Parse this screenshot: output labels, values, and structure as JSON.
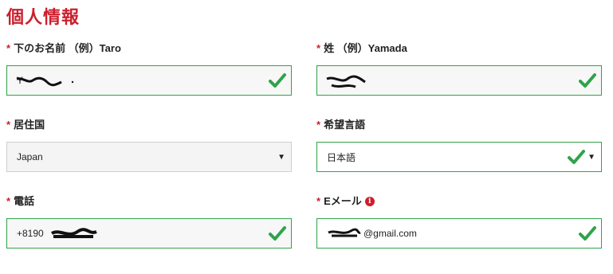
{
  "section_title": "個人情報",
  "required_mark": "*",
  "fields": {
    "first_name": {
      "label": "下のお名前 （例）Taro",
      "value": "Y"
    },
    "last_name": {
      "label": "姓 （例）Yamada",
      "value": ""
    },
    "country": {
      "label": "居住国",
      "value": "Japan"
    },
    "language": {
      "label": "希望言語",
      "value": "日本語"
    },
    "phone": {
      "label": "電話",
      "value": "+8190"
    },
    "email": {
      "label": "Eメール",
      "value": "@gmail.com"
    }
  },
  "icons": {
    "valid": "check-icon",
    "dropdown": "caret-down-icon",
    "info": "info-icon"
  },
  "colors": {
    "brand_red": "#cc1f2d",
    "valid_green": "#2fa34a"
  }
}
